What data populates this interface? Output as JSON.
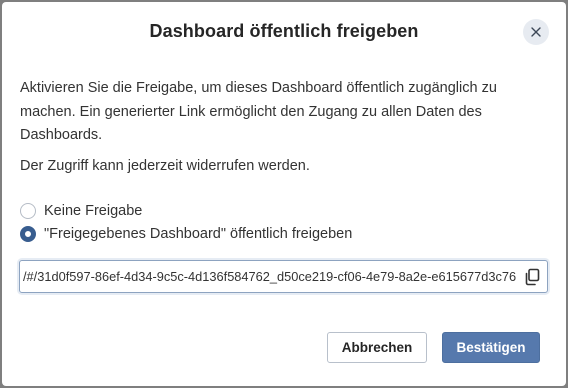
{
  "dialog": {
    "title": "Dashboard öffentlich freigeben",
    "close_icon": "close-icon",
    "description": "Aktivieren Sie die Freigabe, um dieses Dashboard öffentlich zugänglich zu machen. Ein generierter Link ermöglicht den Zugang zu allen Daten des Dashboards.",
    "revoke_note": "Der Zugriff kann jederzeit widerrufen werden.",
    "options": [
      {
        "label": "Keine Freigabe",
        "selected": false
      },
      {
        "label": "\"Freigegebenes Dashboard\" öffentlich freigeben",
        "selected": true
      }
    ],
    "link": {
      "value": "/#/31d0f597-86ef-4d34-9c5c-4d136f584762_d50ce219-cf06-4e79-8a2e-e615677d3c76",
      "copy_icon": "copy-icon"
    },
    "buttons": {
      "cancel_label": "Abbrechen",
      "confirm_label": "Bestätigen"
    },
    "colors": {
      "accent": "#385d8f",
      "primary_button": "#5679ad",
      "overlay": "#7f7f7f"
    }
  }
}
